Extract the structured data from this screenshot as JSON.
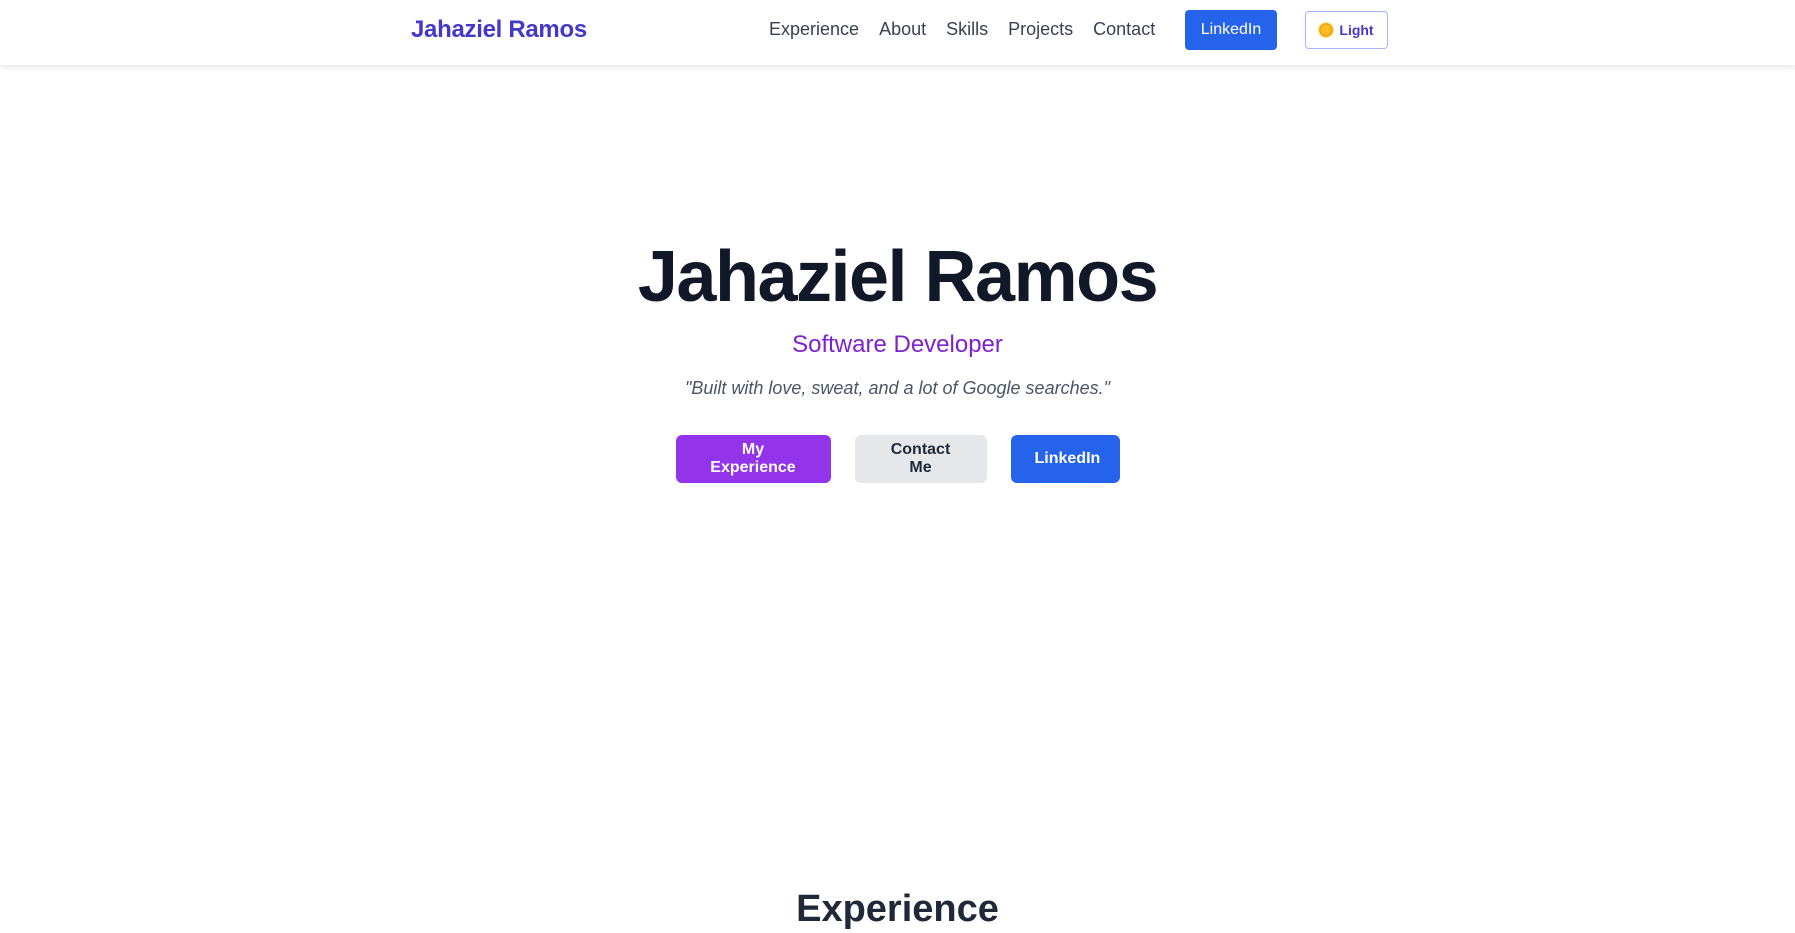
{
  "header": {
    "brand": "Jahaziel Ramos",
    "nav": [
      "Experience",
      "About",
      "Skills",
      "Projects",
      "Contact"
    ],
    "linkedin_label": "LinkedIn",
    "theme_label": "Light"
  },
  "hero": {
    "title": "Jahaziel Ramos",
    "subtitle": "Software Developer",
    "quote": "\"Built with love, sweat, and a lot of Google searches.\"",
    "buttons": {
      "experience": "My Experience",
      "contact": "Contact Me",
      "linkedin": "LinkedIn"
    }
  },
  "sections": {
    "experience_heading": "Experience"
  },
  "colors": {
    "brand": "#4338ca",
    "primary_purple": "#9333ea",
    "linkedin_blue": "#2563eb",
    "subtitle_purple": "#7e22ce"
  },
  "icons": {
    "theme": "sun-icon"
  }
}
